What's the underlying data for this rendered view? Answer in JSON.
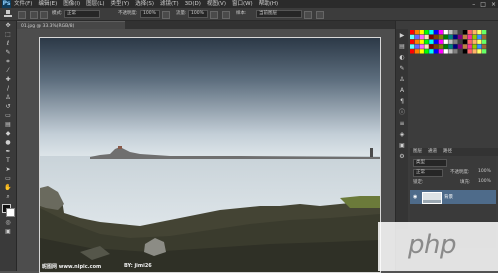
{
  "menubar": {
    "app_icon": "Ps",
    "menus": [
      "文件(F)",
      "编辑(E)",
      "图像(I)",
      "图层(L)",
      "类型(Y)",
      "选择(S)",
      "滤镜(T)",
      "3D(D)",
      "视图(V)",
      "窗口(W)",
      "帮助(H)"
    ],
    "window_controls": [
      "–",
      "□",
      "×"
    ]
  },
  "options": {
    "mode_label": "模式:",
    "mode_value": "正常",
    "opacity_label": "不透明度:",
    "opacity_value": "100%",
    "flow_label": "流量:",
    "flow_value": "100%",
    "sample_label": "样本:",
    "sample_value": "当前图层"
  },
  "document": {
    "tab_title": "01.jpg @ 33.3%(RGB/8)",
    "watermark_left": "昵图网 www.nipic.com",
    "watermark_right": "BY: jimi26"
  },
  "swatch_colors": [
    "#ff0000",
    "#ff8000",
    "#ffff00",
    "#00ff00",
    "#00ffff",
    "#0000ff",
    "#ff00ff",
    "#ffffff",
    "#c0c0c0",
    "#808080",
    "#404040",
    "#000000",
    "#ff6666",
    "#ffb366",
    "#ffff66",
    "#66ff66",
    "#66ffff",
    "#6666ff",
    "#ff66ff",
    "#ffe0c0",
    "#800000",
    "#804000",
    "#808000",
    "#008000",
    "#008080",
    "#000080",
    "#800080",
    "#c08040",
    "#ff3399",
    "#99cc00",
    "#3399ff",
    "#996633"
  ],
  "layers": {
    "tabs": [
      "图层",
      "通道",
      "路径"
    ],
    "kind_label": "类型",
    "blend_value": "正常",
    "opacity_label": "不透明度:",
    "opacity_value": "100%",
    "lock_label": "锁定:",
    "fill_label": "填充:",
    "fill_value": "100%",
    "layer_name": "背景"
  },
  "overlay": {
    "php_text": "php"
  }
}
